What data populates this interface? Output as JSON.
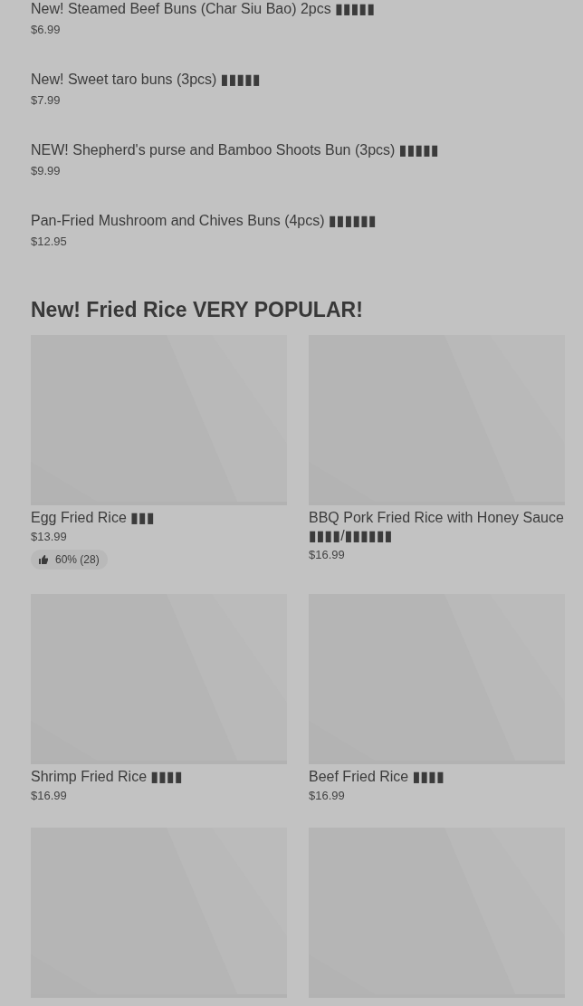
{
  "menu_items": [
    {
      "name": "New! Steamed Beef Buns (Char Siu Bao) 2pcs ▮▮▮▮▮",
      "price": "$6.99"
    },
    {
      "name": "New! Sweet taro buns (3pcs) ▮▮▮▮▮",
      "price": "$7.99"
    },
    {
      "name": "NEW! Shepherd's purse and Bamboo Shoots Bun (3pcs) ▮▮▮▮▮",
      "price": "$9.99"
    },
    {
      "name": "Pan-Fried Mushroom and Chives Buns (4pcs) ▮▮▮▮▮▮",
      "price": "$12.95"
    }
  ],
  "section": {
    "title": "New! Fried Rice VERY POPULAR!",
    "cards": [
      {
        "kind": "picture",
        "name": "Egg Fried Rice ▮▮▮",
        "price": "$13.99",
        "rating": "60% (28)"
      },
      {
        "kind": "picture",
        "name": "BBQ Pork Fried Rice with Honey Sauce ▮▮▮▮/▮▮▮▮▮▮",
        "price": "$16.99"
      },
      {
        "kind": "picture",
        "name": "Shrimp Fried Rice ▮▮▮▮",
        "price": "$16.99"
      },
      {
        "kind": "picture",
        "name": "Beef Fried Rice ▮▮▮▮",
        "price": "$16.99"
      },
      {
        "kind": "picture"
      },
      {
        "kind": "picture"
      }
    ]
  }
}
